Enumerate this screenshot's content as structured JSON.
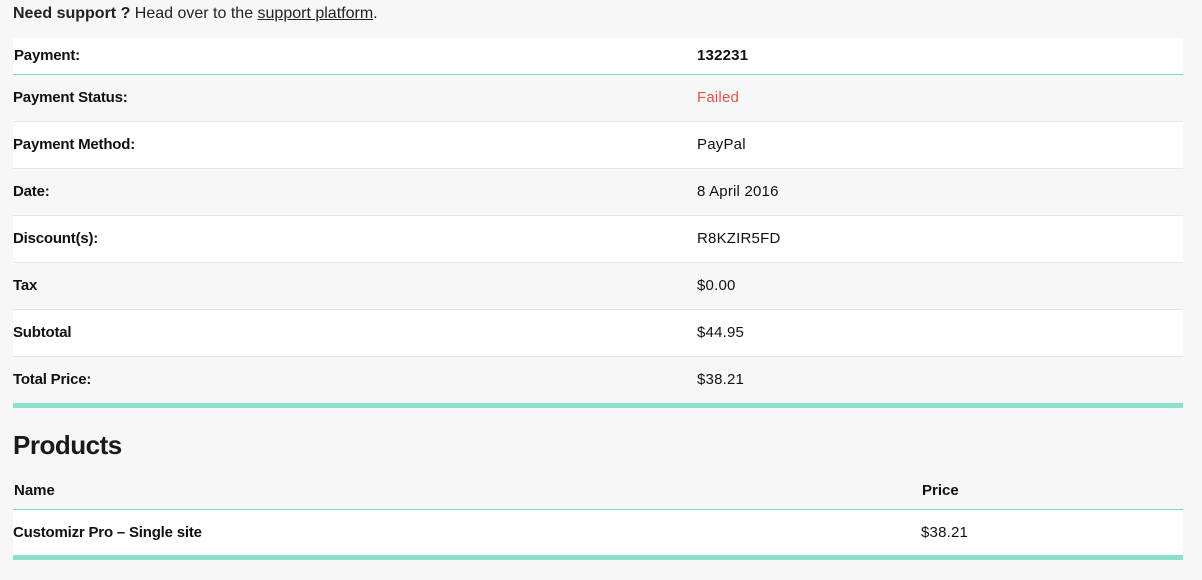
{
  "support": {
    "lead": "Need support ?",
    "text_before_link": " Head over to the ",
    "link_text": "support platform",
    "text_after_link": "."
  },
  "receipt": {
    "header": {
      "label": "Payment:",
      "value": "132231"
    },
    "rows": [
      {
        "label": "Payment Status:",
        "value": "Failed"
      },
      {
        "label": "Payment Method:",
        "value": "PayPal"
      },
      {
        "label": "Date:",
        "value": "8 April 2016"
      },
      {
        "label": "Discount(s):",
        "value": "R8KZIR5FD"
      },
      {
        "label": "Tax",
        "value": "$0.00"
      },
      {
        "label": "Subtotal",
        "value": "$44.95"
      },
      {
        "label": "Total Price:",
        "value": "$38.21"
      }
    ]
  },
  "products": {
    "title": "Products",
    "columns": {
      "name": "Name",
      "price": "Price"
    },
    "items": [
      {
        "name": "Customizr Pro  – Single site",
        "price": "$38.21"
      }
    ]
  },
  "colors": {
    "accent": "#8ce1cc",
    "accent_line": "#7fd9c2",
    "failed": "#e4534a"
  }
}
